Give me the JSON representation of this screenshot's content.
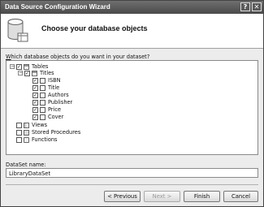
{
  "window": {
    "title": "Data Source Configuration Wizard",
    "help_glyph": "?",
    "close_glyph": "✕"
  },
  "header": {
    "heading": "Choose your database objects",
    "icon": "database-icon"
  },
  "prompt": {
    "text": "Which database objects do you want in your dataset?",
    "accelerator": "W"
  },
  "tree": {
    "nodes": [
      {
        "key": "tables",
        "label": "Tables",
        "expander": "−",
        "checked": true,
        "icon": "tables-icon"
      },
      {
        "key": "titles",
        "label": "Titles",
        "expander": "−",
        "checked": true,
        "icon": "table-icon"
      },
      {
        "key": "isbn",
        "label": "ISBN",
        "checked": true,
        "icon": "column-icon"
      },
      {
        "key": "title",
        "label": "Title",
        "checked": true,
        "icon": "column-icon"
      },
      {
        "key": "authors",
        "label": "Authors",
        "checked": true,
        "icon": "column-icon"
      },
      {
        "key": "publisher",
        "label": "Publisher",
        "checked": true,
        "icon": "column-icon"
      },
      {
        "key": "price",
        "label": "Price",
        "checked": true,
        "icon": "column-icon"
      },
      {
        "key": "cover",
        "label": "Cover",
        "checked": true,
        "icon": "column-icon"
      },
      {
        "key": "views",
        "label": "Views",
        "checked": false,
        "icon": "views-icon"
      },
      {
        "key": "stored_procedures",
        "label": "Stored Procedures",
        "checked": false,
        "icon": "stored-procedures-icon"
      },
      {
        "key": "functions",
        "label": "Functions",
        "checked": false,
        "icon": "functions-icon"
      }
    ]
  },
  "dataset": {
    "label": "DataSet name:",
    "value": "LibraryDataSet"
  },
  "buttons": {
    "previous": "< Previous",
    "next": "Next >",
    "finish": "Finish",
    "cancel": "Cancel"
  },
  "check_glyph": "✓"
}
